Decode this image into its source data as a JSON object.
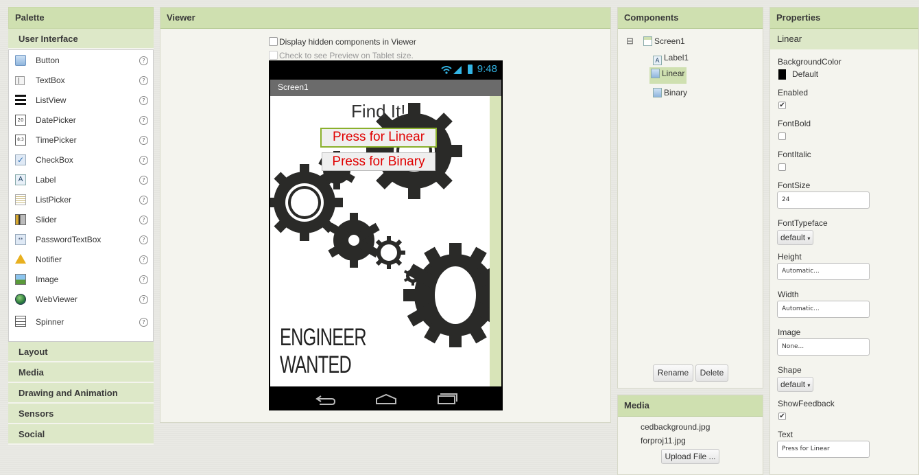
{
  "palette": {
    "title": "Palette",
    "open_category": "User Interface",
    "items": [
      {
        "label": "Button",
        "icon": "button-icon"
      },
      {
        "label": "TextBox",
        "icon": "textbox-icon"
      },
      {
        "label": "ListView",
        "icon": "listview-icon"
      },
      {
        "label": "DatePicker",
        "icon": "datepicker-icon"
      },
      {
        "label": "TimePicker",
        "icon": "timepicker-icon"
      },
      {
        "label": "CheckBox",
        "icon": "checkbox-icon"
      },
      {
        "label": "Label",
        "icon": "label-icon"
      },
      {
        "label": "ListPicker",
        "icon": "listpicker-icon"
      },
      {
        "label": "Slider",
        "icon": "slider-icon"
      },
      {
        "label": "PasswordTextBox",
        "icon": "password-icon"
      },
      {
        "label": "Notifier",
        "icon": "warning-icon"
      },
      {
        "label": "Image",
        "icon": "image-icon"
      },
      {
        "label": "WebViewer",
        "icon": "globe-icon"
      },
      {
        "label": "Spinner",
        "icon": "spinner-icon"
      }
    ],
    "help_glyph": "?",
    "categories": [
      "Layout",
      "Media",
      "Drawing and Animation",
      "Sensors",
      "Social"
    ]
  },
  "viewer": {
    "title": "Viewer",
    "opt_hidden": "Display hidden components in Viewer",
    "opt_tablet": "Check to see Preview on Tablet size.",
    "phone": {
      "time": "9:48",
      "screen_title": "Screen1",
      "heading": "Find It!",
      "btn_linear": "Press for Linear",
      "btn_binary": "Press for Binary",
      "background_text": "ENGINEER WANTED"
    }
  },
  "components": {
    "title": "Components",
    "tree": {
      "root": "Screen1",
      "collapse_glyph": "⊟",
      "children": [
        "Label1",
        "Linear",
        "Binary"
      ],
      "selected": "Linear"
    },
    "rename_label": "Rename",
    "delete_label": "Delete"
  },
  "media": {
    "title": "Media",
    "files": [
      "cedbackground.jpg",
      "forproj11.jpg"
    ],
    "upload_label": "Upload File ..."
  },
  "properties": {
    "title": "Properties",
    "component": "Linear",
    "background_color_label": "BackgroundColor",
    "background_color_value": "Default",
    "enabled_label": "Enabled",
    "fontbold_label": "FontBold",
    "fontitalic_label": "FontItalic",
    "fontsize_label": "FontSize",
    "fontsize_value": "24",
    "fonttypeface_label": "FontTypeface",
    "fonttypeface_value": "default",
    "height_label": "Height",
    "height_value": "Automatic...",
    "width_label": "Width",
    "width_value": "Automatic...",
    "image_label": "Image",
    "image_value": "None...",
    "shape_label": "Shape",
    "shape_value": "default",
    "showfeedback_label": "ShowFeedback",
    "text_label": "Text",
    "text_value": "Press for Linear",
    "check_glyph": "✔",
    "select_arrow": "▾"
  },
  "colors": {
    "header_green": "#cfe0b0",
    "selected_green": "#cfe0b0",
    "button_text_red": "#e00000",
    "clock_blue": "#33b5e5"
  }
}
